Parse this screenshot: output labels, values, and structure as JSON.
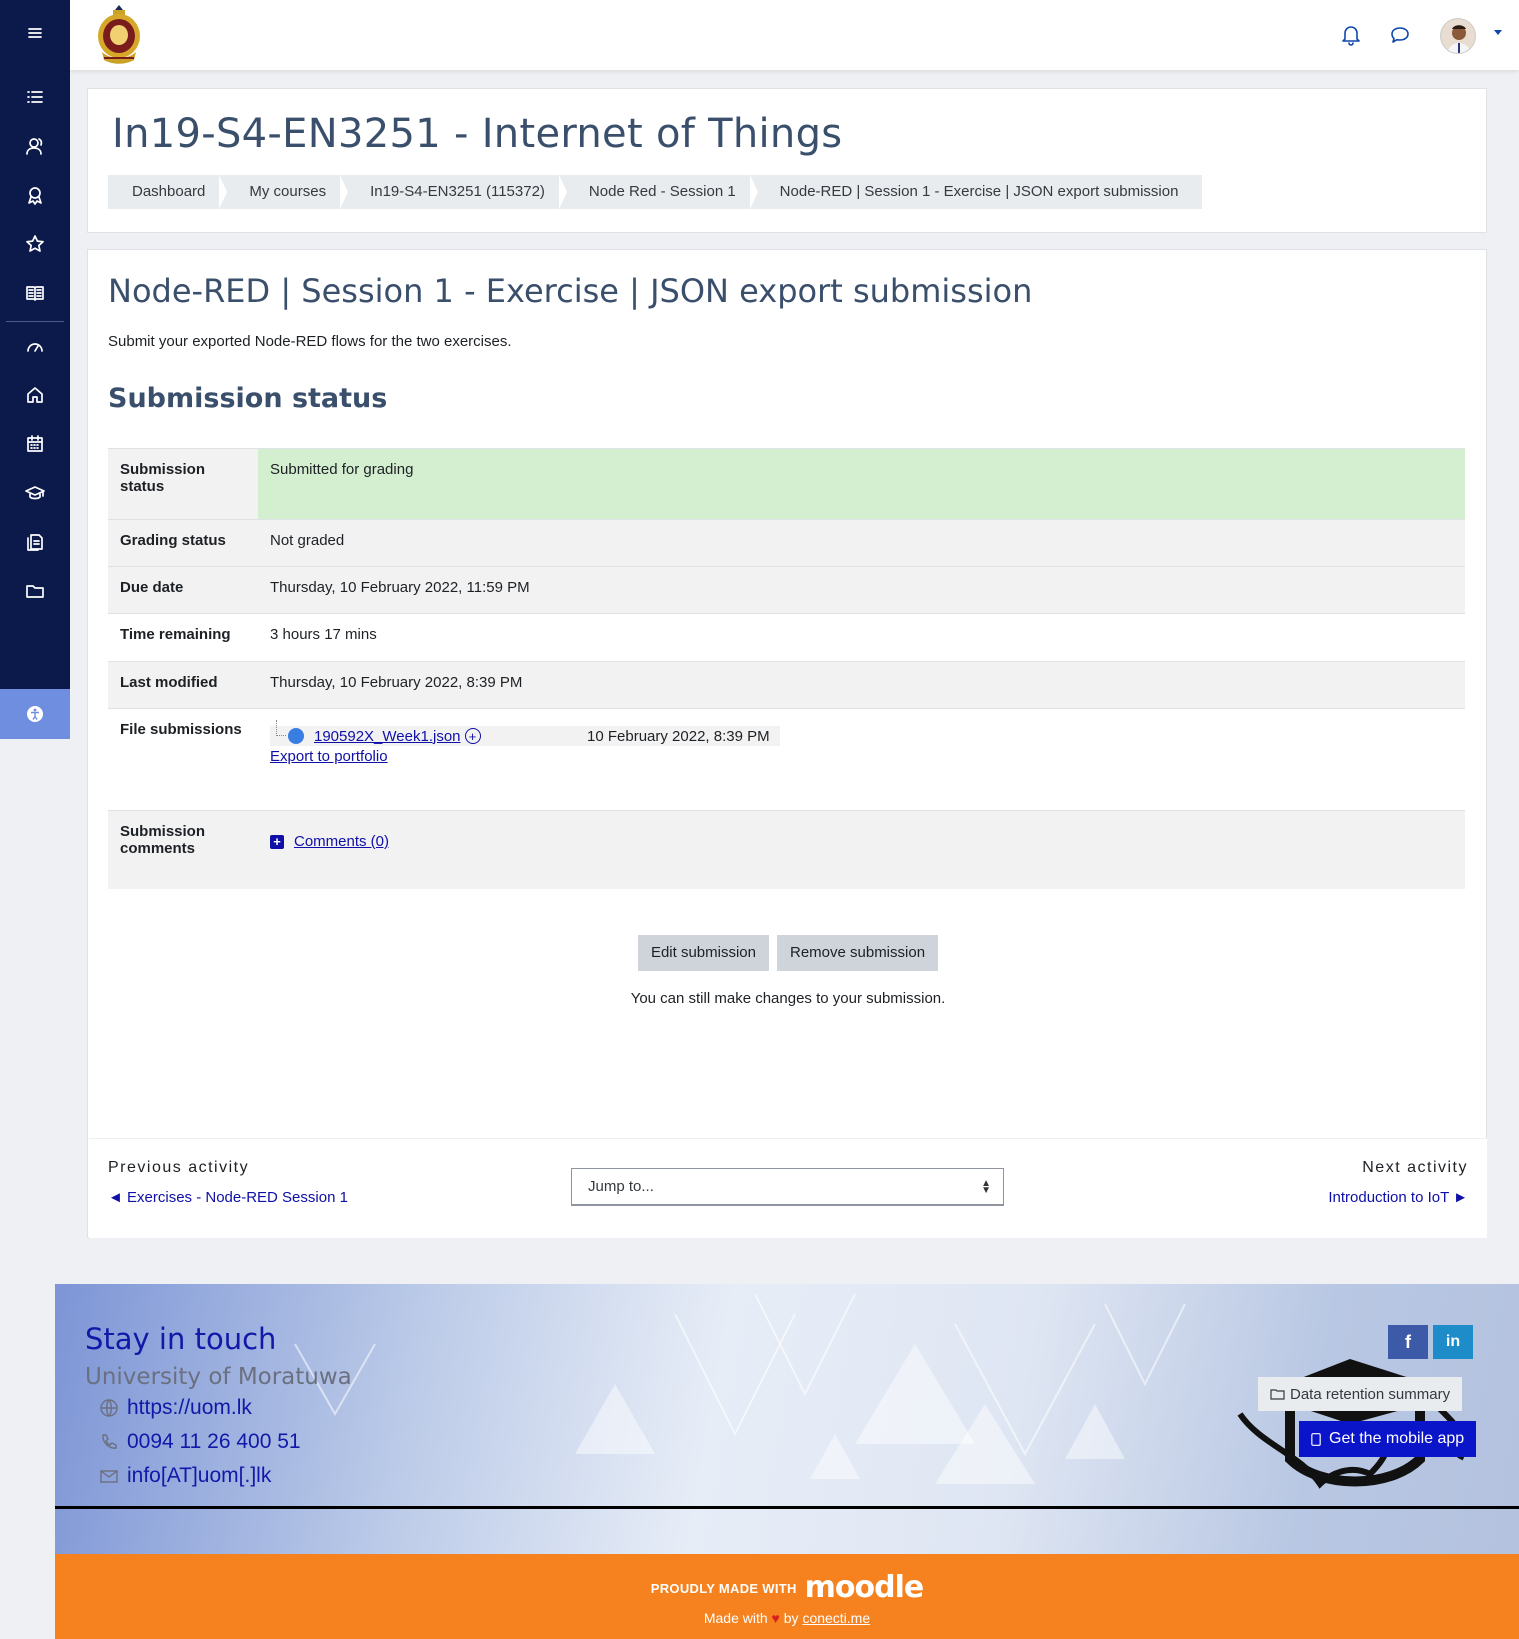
{
  "navbar": {
    "icons": [
      "menu-icon",
      "list-icon",
      "users-icon",
      "award-icon",
      "star-icon",
      "book-icon",
      "dashboard-icon",
      "home-icon",
      "calendar-icon",
      "graduation-icon",
      "files-icon",
      "folder-icon",
      "accessibility-icon"
    ],
    "top_icons": [
      "bell-icon",
      "message-icon"
    ]
  },
  "header": {
    "course_title": "In19-S4-EN3251 - Internet of Things",
    "breadcrumb": [
      "Dashboard",
      "My courses",
      "In19-S4-EN3251 (115372)",
      "Node Red - Session 1",
      "Node-RED | Session 1 - Exercise | JSON export submission"
    ]
  },
  "main": {
    "title": "Node-RED | Session 1 - Exercise | JSON export submission",
    "intro": "Submit your exported Node-RED flows for the two exercises.",
    "section_heading": "Submission status",
    "rows": {
      "submission_status": {
        "label": "Submission status",
        "value": "Submitted for grading"
      },
      "grading_status": {
        "label": "Grading status",
        "value": "Not graded"
      },
      "due_date": {
        "label": "Due date",
        "value": "Thursday, 10 February 2022, 11:59 PM"
      },
      "time_remaining": {
        "label": "Time remaining",
        "value": "3 hours 17 mins"
      },
      "last_modified": {
        "label": "Last modified",
        "value": "Thursday, 10 February 2022, 8:39 PM"
      },
      "file_submissions": {
        "label": "File submissions",
        "file_name": "190592X_Week1.json",
        "file_date": "10 February 2022, 8:39 PM",
        "portfolio": "Export to portfolio"
      },
      "submission_comments": {
        "label": "Submission comments",
        "comments": "Comments (0)"
      }
    },
    "buttons": {
      "edit": "Edit submission",
      "remove": "Remove submission"
    },
    "note": "You can still make changes to your submission."
  },
  "activity_nav": {
    "prev_label": "Previous activity",
    "prev_link": "◄ Exercises - Node-RED Session 1",
    "jump_placeholder": "Jump to...",
    "next_label": "Next activity",
    "next_link": "Introduction to IoT ►"
  },
  "footer": {
    "stay": "Stay in touch",
    "university": "University of Moratuwa",
    "website": "https://uom.lk",
    "phone": "0094 11 26 400 51",
    "email": "info[AT]uom[.]lk",
    "social": [
      "f",
      "in"
    ],
    "data_retention": "Data retention summary",
    "mobile_app": "Get the mobile app",
    "made_with_prefix": "PROUDLY MADE WITH",
    "moodle": "moodle",
    "made_with": "Made with",
    "by": "by",
    "conecti": "conecti.me"
  },
  "colors": {
    "sidebar": "#0b1a4a",
    "accent": "#0f47ad",
    "link": "#0f0fa8",
    "success_bg": "#d4efd0",
    "orange": "#f5821f"
  }
}
